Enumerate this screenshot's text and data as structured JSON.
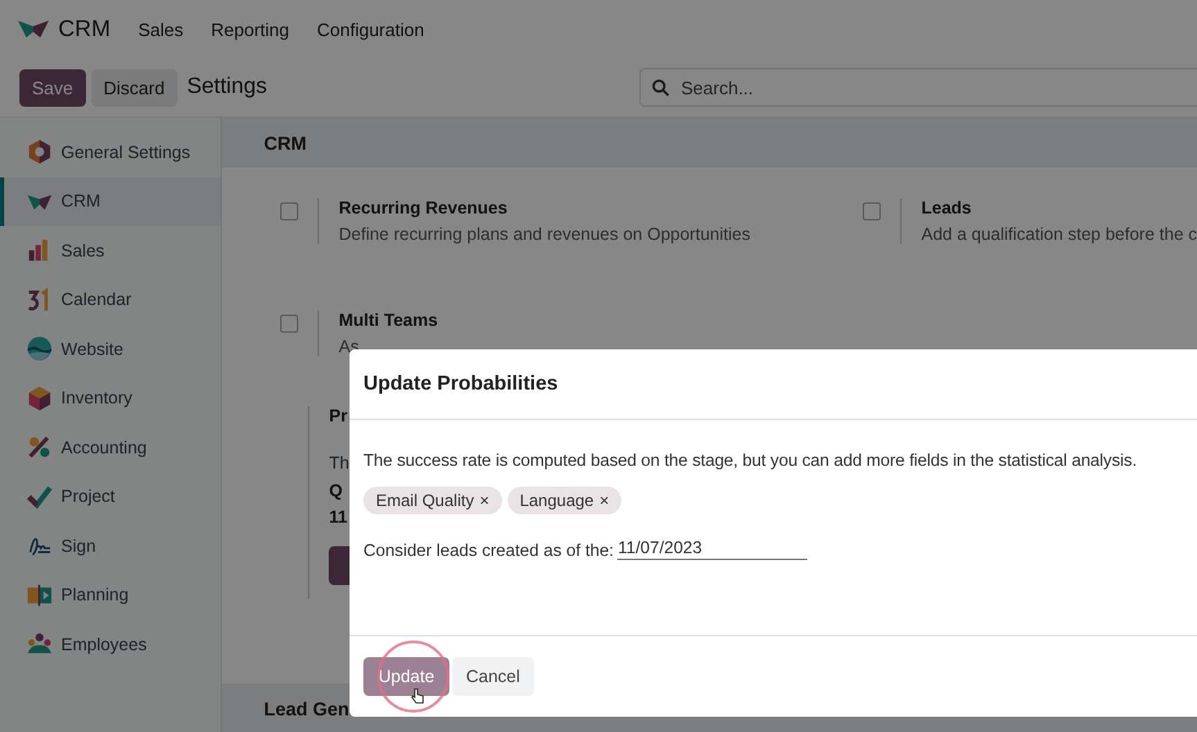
{
  "top_nav": {
    "app": "CRM",
    "menu": [
      "Sales",
      "Reporting",
      "Configuration"
    ]
  },
  "control_bar": {
    "save": "Save",
    "discard": "Discard",
    "title": "Settings",
    "search": {
      "placeholder": "Search..."
    }
  },
  "sidebar": {
    "items": [
      {
        "label": "General Settings",
        "selected": false
      },
      {
        "label": "CRM",
        "selected": true
      },
      {
        "label": "Sales",
        "selected": false
      },
      {
        "label": "Calendar",
        "selected": false
      },
      {
        "label": "Website",
        "selected": false
      },
      {
        "label": "Inventory",
        "selected": false
      },
      {
        "label": "Accounting",
        "selected": false
      },
      {
        "label": "Project",
        "selected": false
      },
      {
        "label": "Sign",
        "selected": false
      },
      {
        "label": "Planning",
        "selected": false
      },
      {
        "label": "Employees",
        "selected": false
      }
    ]
  },
  "section": {
    "title": "CRM",
    "settings": [
      {
        "title": "Recurring Revenues",
        "description": "Define recurring plans and revenues on Opportunities",
        "checked": false
      },
      {
        "title": "Leads",
        "description": "Add a qualification step before the c",
        "checked": false
      },
      {
        "title": "Multi Teams",
        "description": "As",
        "checked": false
      }
    ],
    "partial_setting": {
      "title": "Pr",
      "lines": [
        {
          "text": "Th",
          "bold": false
        },
        {
          "text": "Q",
          "bold": true
        },
        {
          "text": "11",
          "bold": true
        }
      ]
    }
  },
  "next_section": {
    "title": "Lead Gen"
  },
  "dialog": {
    "title": "Update Probabilities",
    "text": "The success rate is computed based on the stage, but you can add more fields in the statistical analysis.",
    "tags": [
      {
        "label": "Email Quality",
        "remove": "×"
      },
      {
        "label": "Language",
        "remove": "×"
      }
    ],
    "date_field": {
      "label": "Consider leads created as of the:",
      "value": "11/07/2023"
    },
    "buttons": [
      {
        "label": "Update",
        "kind": "primary"
      },
      {
        "label": "Cancel",
        "kind": "secondary"
      }
    ]
  }
}
